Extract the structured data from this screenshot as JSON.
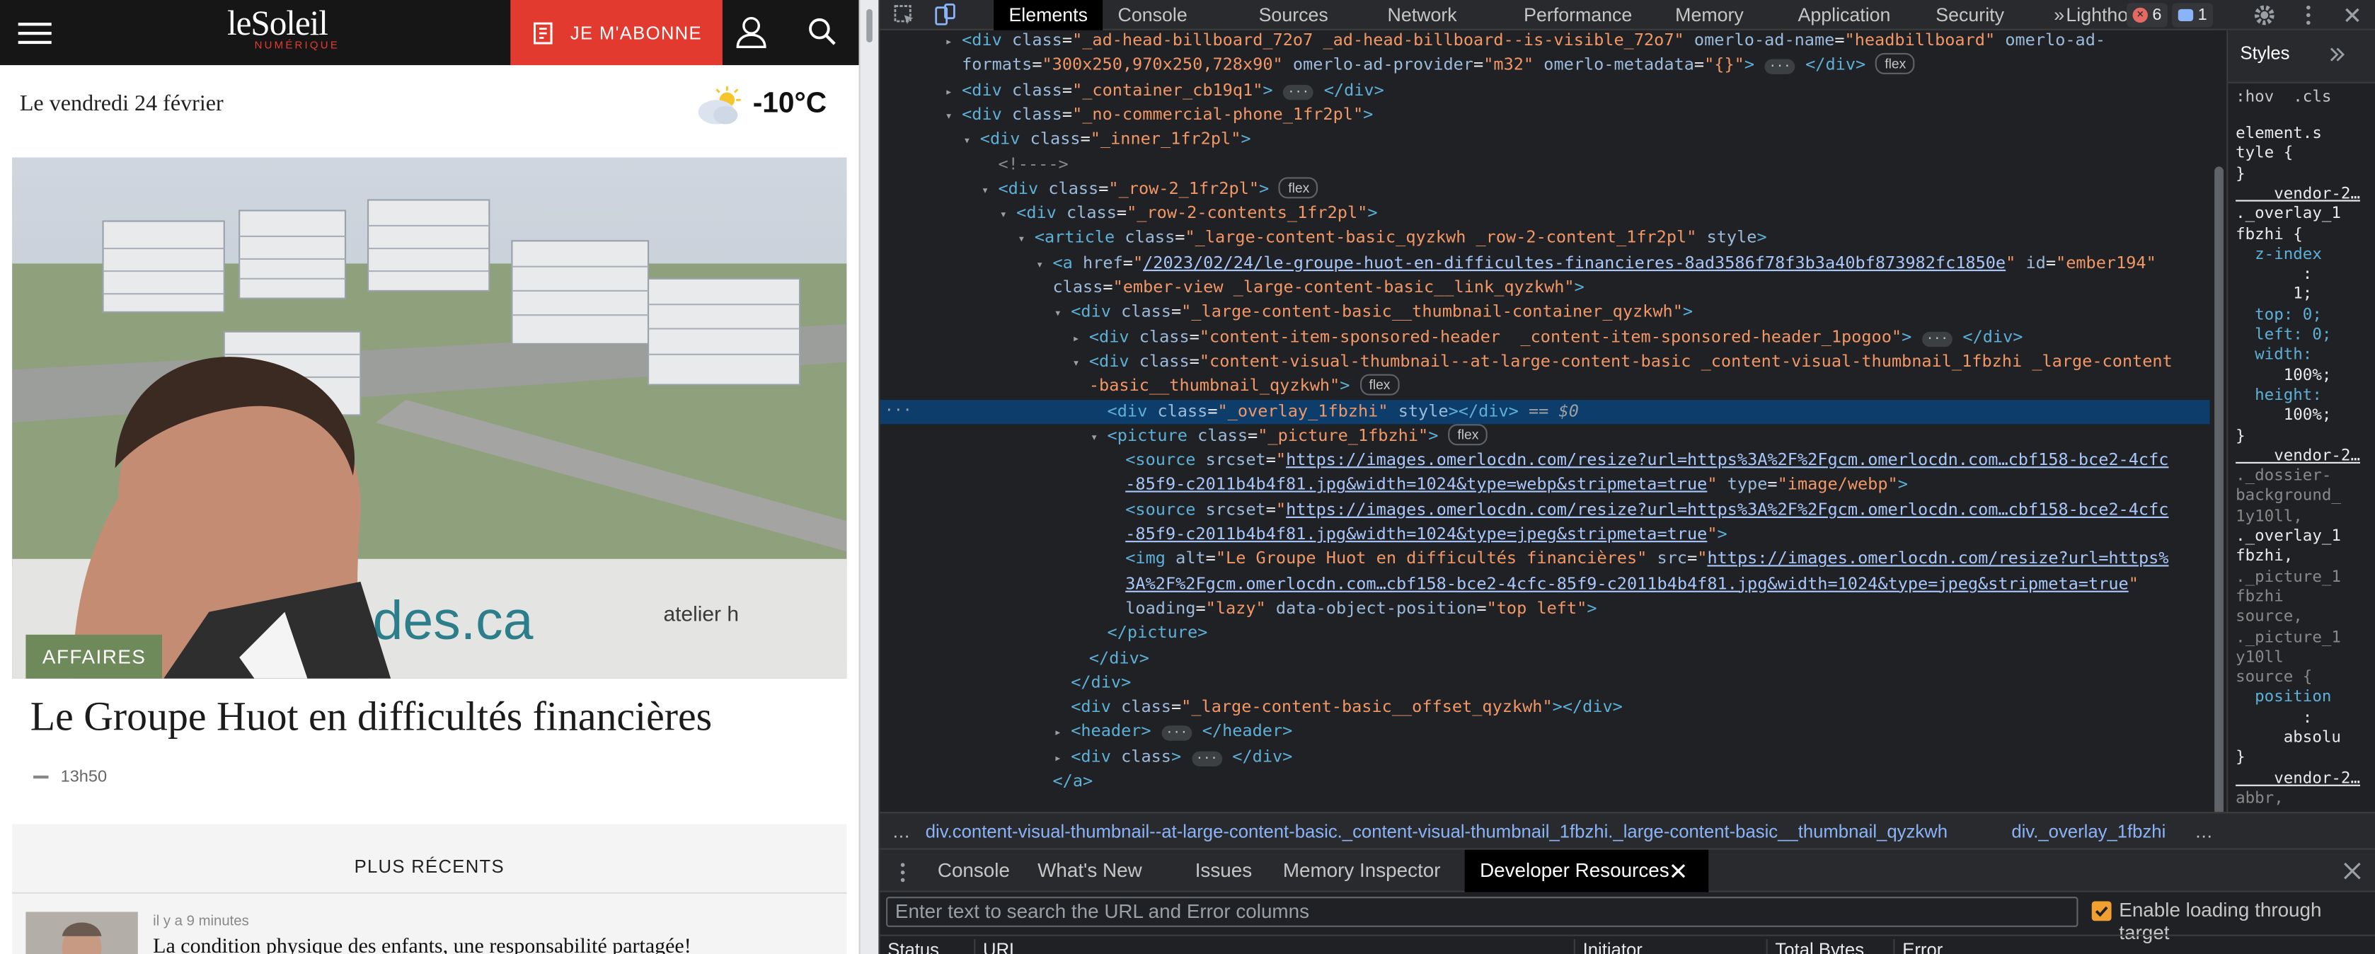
{
  "site": {
    "logo_main": "leSoleil",
    "logo_sub": "NUMÉRIQUE",
    "subscribe_label": "JE M'ABONNE",
    "date_line": "Le vendredi 24 février",
    "temperature": "-10°C",
    "weather_icon": "partly-cloudy-icon",
    "hero": {
      "category": "AFFAIRES",
      "title": "Le Groupe Huot en difficultés financières",
      "time": "13h50",
      "image_alt": "Le Groupe Huot en difficultés financières",
      "billboard_text": "des.ca",
      "billboard_brand": "atelier h"
    },
    "recent": {
      "heading": "PLUS RÉCENTS",
      "items": [
        {
          "ago": "il y a 9 minutes",
          "title": "La condition physique des enfants, une responsabilité partagée!"
        }
      ]
    }
  },
  "devtools": {
    "tabs": [
      "Elements",
      "Console",
      "Sources",
      "Network",
      "Performance",
      "Memory",
      "Application",
      "Security",
      "Lighthouse"
    ],
    "more": "»",
    "error_count": "6",
    "message_count": "1",
    "dom_lines": [
      {
        "indent": 3,
        "tri": "▸",
        "html": "<span class=\"tg\">&lt;div</span> <span class=\"at\">class</span>=<span class=\"av\">\"_ad-head-billboard_72o7 _ad-head-billboard--is-visible_72o7\"</span> <span class=\"at\">omerlo-ad-name</span>=<span class=\"av\">\"headbillboard\"</span> <span class=\"at\">omerlo-ad-</span>"
      },
      {
        "indent": 3,
        "tri": "",
        "html": "<span class=\"at\">formats</span>=<span class=\"av\">\"300x250,970x250,728x90\"</span> <span class=\"at\">omerlo-ad-provider</span>=<span class=\"av\">\"m32\"</span> <span class=\"at\">omerlo-metadata</span>=<span class=\"av\">\"{}\"</span><span class=\"tg\">&gt;</span> <span class=\"ell\">···</span> <span class=\"tg\">&lt;/div&gt;</span> <span class=\"chip\">flex</span>"
      },
      {
        "indent": 3,
        "tri": "▸",
        "html": "<span class=\"tg\">&lt;div</span> <span class=\"at\">class</span>=<span class=\"av\">\"_container_cb19q1\"</span><span class=\"tg\">&gt;</span> <span class=\"ell\">···</span> <span class=\"tg\">&lt;/div&gt;</span>"
      },
      {
        "indent": 3,
        "tri": "▾",
        "html": "<span class=\"tg\">&lt;div</span> <span class=\"at\">class</span>=<span class=\"av\">\"_no-commercial-phone_1fr2pl\"</span><span class=\"tg\">&gt;</span>"
      },
      {
        "indent": 4,
        "tri": "▾",
        "html": "<span class=\"tg\">&lt;div</span> <span class=\"at\">class</span>=<span class=\"av\">\"_inner_1fr2pl\"</span><span class=\"tg\">&gt;</span>"
      },
      {
        "indent": 5,
        "tri": "",
        "html": "<span class=\"cm\">&lt;!----&gt;</span>"
      },
      {
        "indent": 5,
        "tri": "▾",
        "html": "<span class=\"tg\">&lt;div</span> <span class=\"at\">class</span>=<span class=\"av\">\"_row-2_1fr2pl\"</span><span class=\"tg\">&gt;</span> <span class=\"chip\">flex</span>"
      },
      {
        "indent": 6,
        "tri": "▾",
        "html": "<span class=\"tg\">&lt;div</span> <span class=\"at\">class</span>=<span class=\"av\">\"_row-2-contents_1fr2pl\"</span><span class=\"tg\">&gt;</span>"
      },
      {
        "indent": 7,
        "tri": "▾",
        "html": "<span class=\"tg\">&lt;article</span> <span class=\"at\">class</span>=<span class=\"av\">\"_large-content-basic_qyzkwh _row-2-content_1fr2pl\"</span> <span class=\"at\">style</span><span class=\"tg\">&gt;</span>"
      },
      {
        "indent": 8,
        "tri": "▾",
        "html": "<span class=\"tg\">&lt;a</span> <span class=\"at\">href</span>=<span class=\"av\">\"</span><span class=\"lk\">/2023/02/24/le-groupe-huot-en-difficultes-financieres-8ad3586f78f3b3a40bf873982fc1850e</span><span class=\"av\">\"</span> <span class=\"at\">id</span>=<span class=\"av\">\"ember194\"</span>"
      },
      {
        "indent": 8,
        "tri": "",
        "html": "<span class=\"at\">class</span>=<span class=\"av\">\"ember-view _large-content-basic__link_qyzkwh\"</span><span class=\"tg\">&gt;</span>"
      },
      {
        "indent": 9,
        "tri": "▾",
        "html": "<span class=\"tg\">&lt;div</span> <span class=\"at\">class</span>=<span class=\"av\">\"_large-content-basic__thumbnail-container_qyzkwh\"</span><span class=\"tg\">&gt;</span>"
      },
      {
        "indent": 10,
        "tri": "▸",
        "html": "<span class=\"tg\">&lt;div</span> <span class=\"at\">class</span>=<span class=\"av\">\"content-item-sponsored-header  _content-item-sponsored-header_1pogoo\"</span><span class=\"tg\">&gt;</span> <span class=\"ell\">···</span> <span class=\"tg\">&lt;/div&gt;</span>"
      },
      {
        "indent": 10,
        "tri": "▾",
        "html": "<span class=\"tg\">&lt;div</span> <span class=\"at\">class</span>=<span class=\"av\">\"content-visual-thumbnail--at-large-content-basic _content-visual-thumbnail_1fbzhi _large-content</span>"
      },
      {
        "indent": 10,
        "tri": "",
        "html": "<span class=\"av\">-basic__thumbnail_qyzkwh\"</span><span class=\"tg\">&gt;</span> <span class=\"chip\">flex</span>"
      },
      {
        "indent": 11,
        "tri": "",
        "sel": true,
        "html": "<span class=\"tg\">&lt;div</span> <span class=\"at\">class</span>=<span class=\"av\">\"_overlay_1fbzhi\"</span> <span class=\"at\">style</span><span class=\"tg\">&gt;&lt;/div&gt;</span> <span class=\"eq\">== <i>$0</i></span>"
      },
      {
        "indent": 11,
        "tri": "▾",
        "html": "<span class=\"tg\">&lt;picture</span> <span class=\"at\">class</span>=<span class=\"av\">\"_picture_1fbzhi\"</span><span class=\"tg\">&gt;</span> <span class=\"chip\">flex</span>"
      },
      {
        "indent": 12,
        "tri": "",
        "html": "<span class=\"tg\">&lt;source</span> <span class=\"at\">srcset</span>=<span class=\"av\">\"</span><span class=\"lk\">https://images.omerlocdn.com/resize?url=https%3A%2F%2Fgcm.omerlocdn.com…cbf158-bce2-4cfc</span>"
      },
      {
        "indent": 12,
        "tri": "",
        "html": "<span class=\"lk\">-85f9-c2011b4b4f81.jpg&amp;width=1024&amp;type=webp&amp;stripmeta=true</span><span class=\"av\">\"</span> <span class=\"at\">type</span>=<span class=\"av\">\"image/webp\"</span><span class=\"tg\">&gt;</span>"
      },
      {
        "indent": 12,
        "tri": "",
        "html": "<span class=\"tg\">&lt;source</span> <span class=\"at\">srcset</span>=<span class=\"av\">\"</span><span class=\"lk\">https://images.omerlocdn.com/resize?url=https%3A%2F%2Fgcm.omerlocdn.com…cbf158-bce2-4cfc</span>"
      },
      {
        "indent": 12,
        "tri": "",
        "html": "<span class=\"lk\">-85f9-c2011b4b4f81.jpg&amp;width=1024&amp;type=jpeg&amp;stripmeta=true</span><span class=\"av\">\"</span><span class=\"tg\">&gt;</span>"
      },
      {
        "indent": 12,
        "tri": "",
        "html": "<span class=\"tg\">&lt;img</span> <span class=\"at\">alt</span>=<span class=\"av\">\"Le Groupe Huot en difficultés financières\"</span> <span class=\"at\">src</span>=<span class=\"av\">\"</span><span class=\"lk\">https://images.omerlocdn.com/resize?url=https%</span>"
      },
      {
        "indent": 12,
        "tri": "",
        "html": "<span class=\"lk\">3A%2F%2Fgcm.omerlocdn.com…cbf158-bce2-4cfc-85f9-c2011b4b4f81.jpg&amp;width=1024&amp;type=jpeg&amp;stripmeta=true</span><span class=\"av\">\"</span>"
      },
      {
        "indent": 12,
        "tri": "",
        "html": "<span class=\"at\">loading</span>=<span class=\"av\">\"lazy\"</span> <span class=\"at\">data-object-position</span>=<span class=\"av\">\"top left\"</span><span class=\"tg\">&gt;</span>"
      },
      {
        "indent": 11,
        "tri": "",
        "html": "<span class=\"tg\">&lt;/picture&gt;</span>"
      },
      {
        "indent": 10,
        "tri": "",
        "html": "<span class=\"tg\">&lt;/div&gt;</span>"
      },
      {
        "indent": 9,
        "tri": "",
        "html": "<span class=\"tg\">&lt;/div&gt;</span>"
      },
      {
        "indent": 9,
        "tri": "",
        "html": "<span class=\"tg\">&lt;div</span> <span class=\"at\">class</span>=<span class=\"av\">\"_large-content-basic__offset_qyzkwh\"</span><span class=\"tg\">&gt;&lt;/div&gt;</span>"
      },
      {
        "indent": 9,
        "tri": "▸",
        "html": "<span class=\"tg\">&lt;header&gt;</span> <span class=\"ell\">···</span> <span class=\"tg\">&lt;/header&gt;</span>"
      },
      {
        "indent": 9,
        "tri": "▸",
        "html": "<span class=\"tg\">&lt;div</span> <span class=\"at\">class</span><span class=\"tg\">&gt;</span> <span class=\"ell\">···</span> <span class=\"tg\">&lt;/div&gt;</span>"
      },
      {
        "indent": 8,
        "tri": "",
        "html": "<span class=\"tg\">&lt;/a&gt;</span>"
      }
    ],
    "styles": {
      "tab": "Styles",
      "filter": ":hov  .cls",
      "lines": [
        {
          "cls": "sel-txt",
          "t": "element.s"
        },
        {
          "cls": "sel-txt",
          "t": "tyle {"
        },
        {
          "cls": "sel-txt",
          "t": "}"
        },
        {
          "cls": "src",
          "t": "    vendor-2…"
        },
        {
          "cls": "sel-txt",
          "t": "._overlay_1"
        },
        {
          "cls": "sel-txt",
          "t": "fbzhi {"
        },
        {
          "cls": "pr",
          "t": "  z-index"
        },
        {
          "cls": "sel-txt",
          "t": "       :"
        },
        {
          "cls": "sel-txt",
          "t": "      1;"
        },
        {
          "cls": "pr",
          "t": "  top: 0;"
        },
        {
          "cls": "pr",
          "t": "  left: 0;"
        },
        {
          "cls": "pr",
          "t": "  width:"
        },
        {
          "cls": "sel-txt",
          "t": "     100%;"
        },
        {
          "cls": "pr",
          "t": "  height:"
        },
        {
          "cls": "sel-txt",
          "t": "     100%;"
        },
        {
          "cls": "sel-txt",
          "t": "}"
        },
        {
          "cls": "src",
          "t": "    vendor-2…"
        },
        {
          "cls": "cm",
          "t": "._dossier-"
        },
        {
          "cls": "cm",
          "t": "background_"
        },
        {
          "cls": "cm",
          "t": "1y10ll,"
        },
        {
          "cls": "sel-txt",
          "t": "._overlay_1"
        },
        {
          "cls": "sel-txt",
          "t": "fbzhi,"
        },
        {
          "cls": "cm",
          "t": "._picture_1"
        },
        {
          "cls": "cm",
          "t": "fbzhi"
        },
        {
          "cls": "cm",
          "t": "source,"
        },
        {
          "cls": "cm",
          "t": "._picture_1"
        },
        {
          "cls": "cm",
          "t": "y10ll"
        },
        {
          "cls": "cm",
          "t": "source {"
        },
        {
          "cls": "pr",
          "t": "  position"
        },
        {
          "cls": "sel-txt",
          "t": "       :"
        },
        {
          "cls": "sel-txt",
          "t": "     absolu"
        },
        {
          "cls": "sel-txt",
          "t": "}"
        },
        {
          "cls": "src",
          "t": "    vendor-2…"
        },
        {
          "cls": "cm",
          "t": "abbr,"
        }
      ]
    },
    "breadcrumb_more": "…",
    "breadcrumb_1": "div.content-visual-thumbnail--at-large-content-basic._content-visual-thumbnail_1fbzhi._large-content-basic__thumbnail_qyzkwh",
    "breadcrumb_2": "div._overlay_1fbzhi",
    "drawer_tabs": [
      "Console",
      "What's New",
      "Issues",
      "Memory Inspector",
      "Developer Resources"
    ],
    "filter_placeholder": "Enter text to search the URL and Error columns",
    "enable_loading_label": "Enable loading through target",
    "columns": [
      "Status",
      "URL",
      "Initiator",
      "Total Bytes",
      "Error"
    ]
  },
  "colors": {
    "accent_red": "#e23a2e",
    "category_green": "#6e8a5a",
    "selection_blue": "#0d3e6b"
  }
}
